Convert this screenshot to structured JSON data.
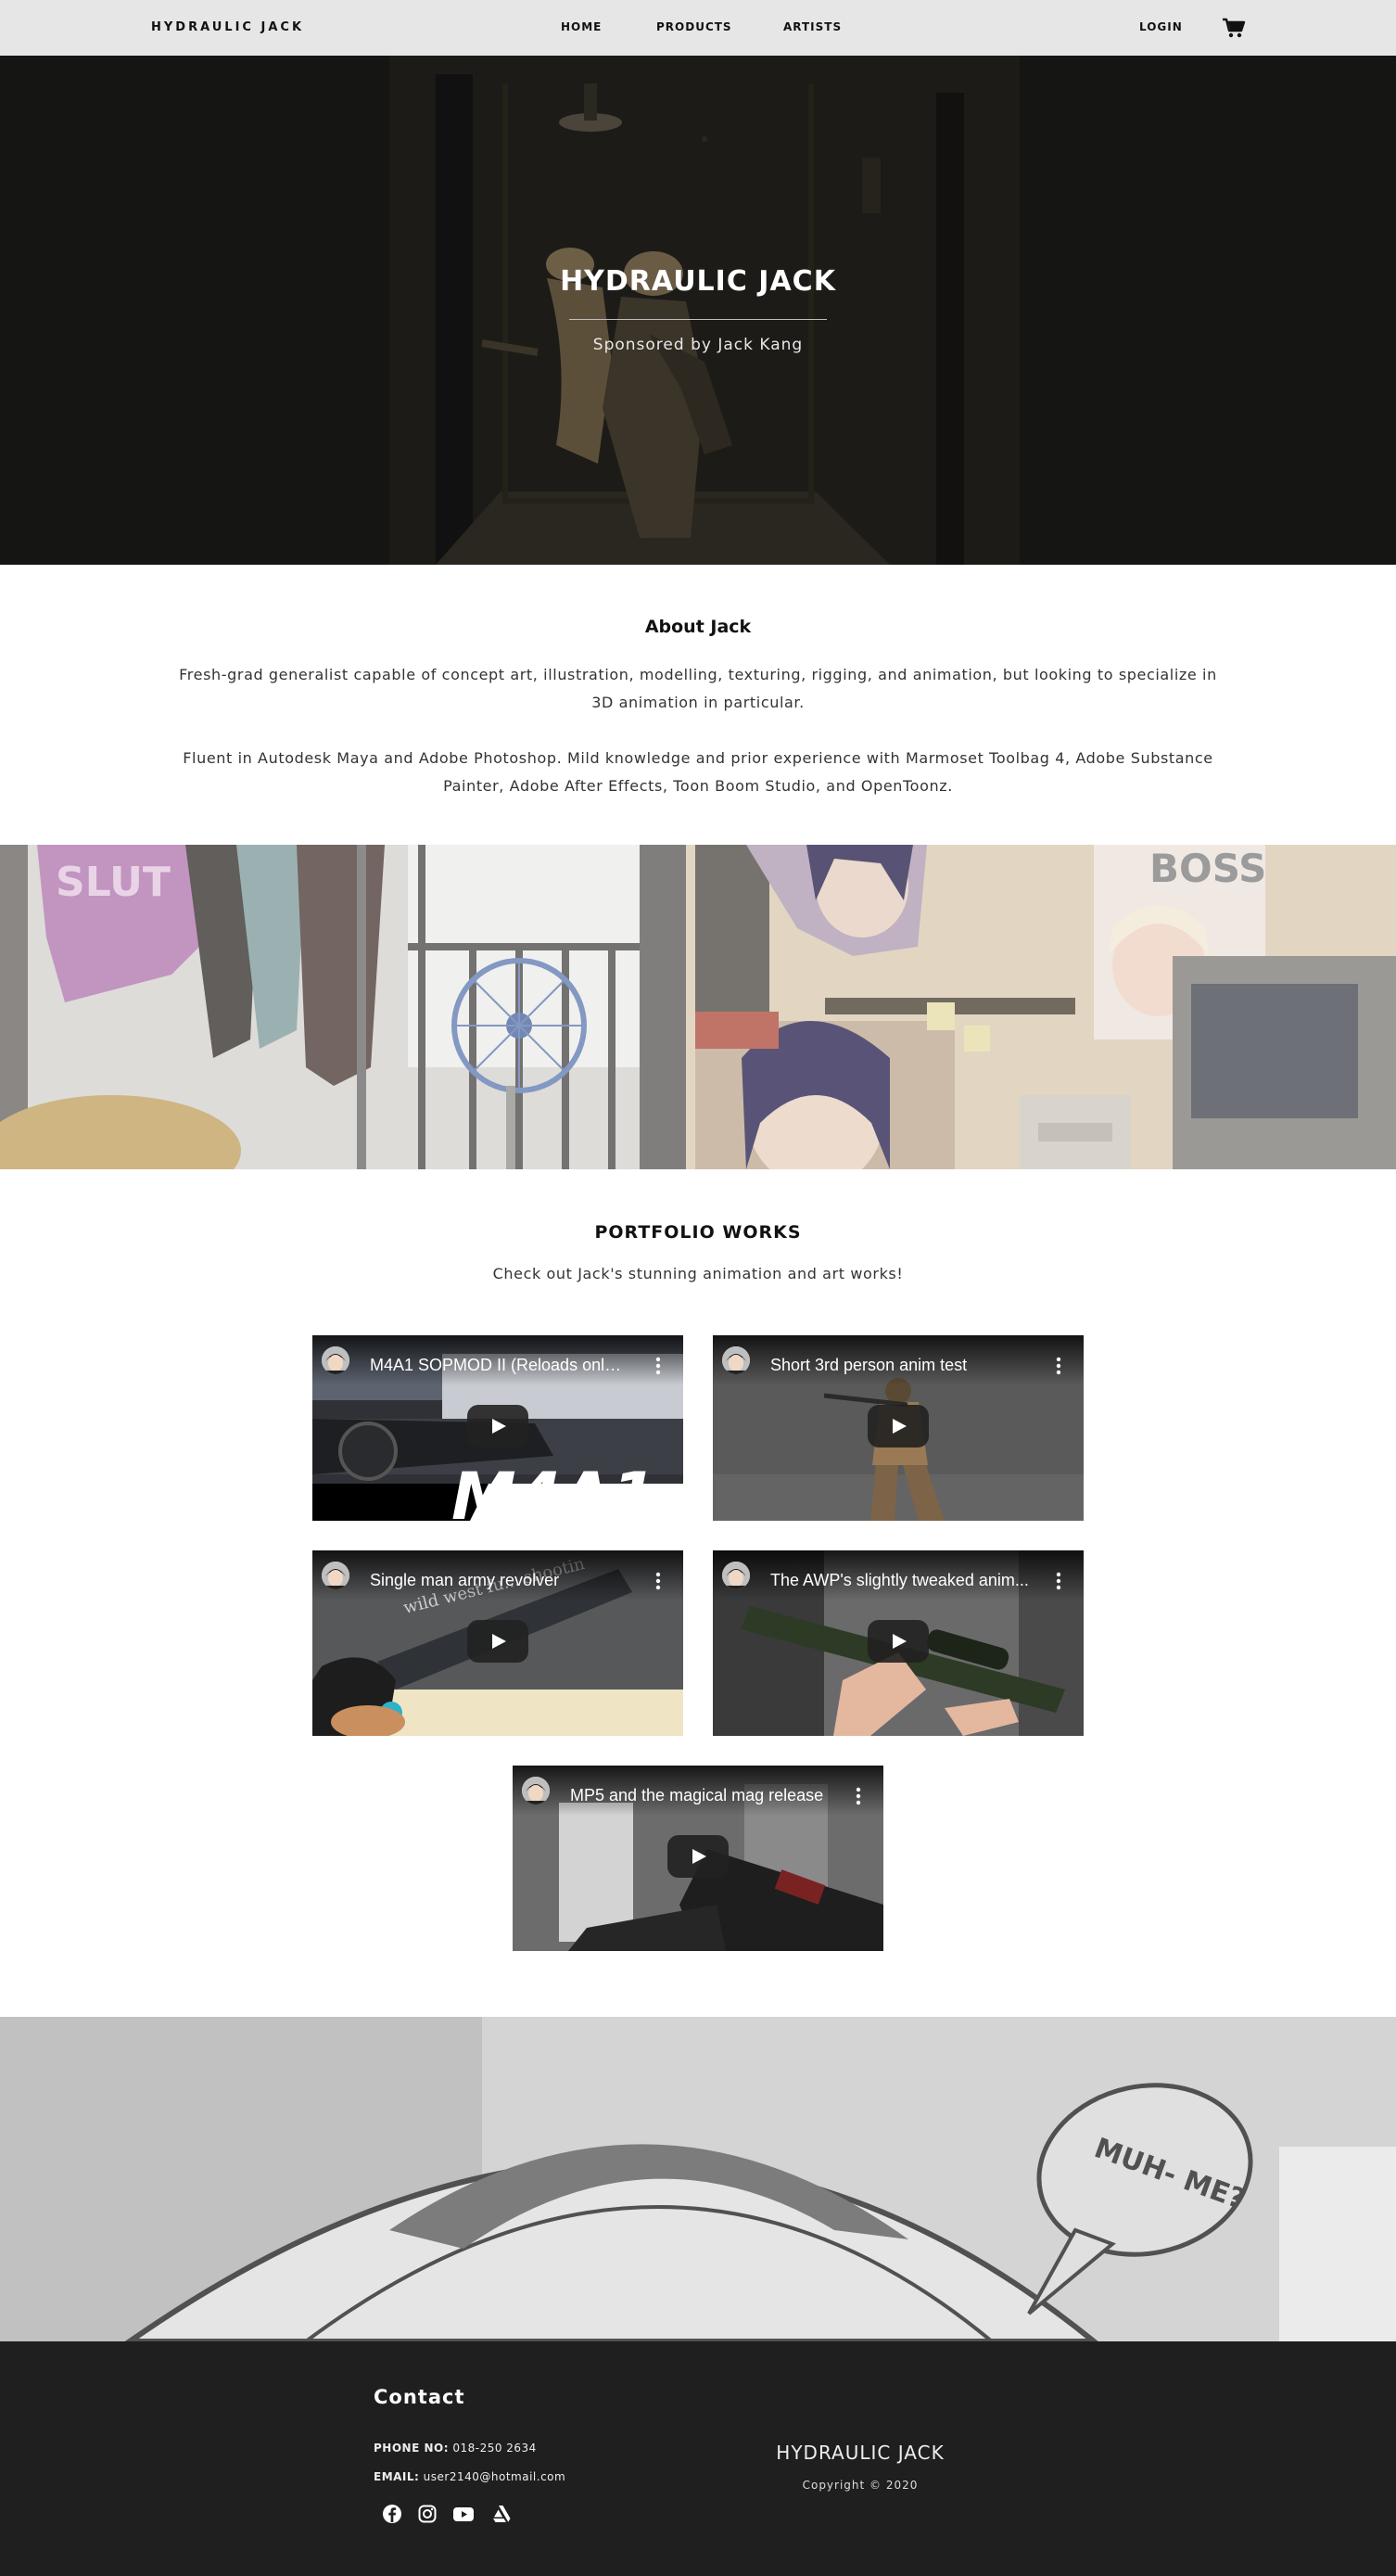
{
  "nav": {
    "brand": "HYDRAULIC JACK",
    "links": [
      "HOME",
      "PRODUCTS",
      "ARTISTS"
    ],
    "login": "LOGIN",
    "cart_icon": "shopping-cart-icon"
  },
  "hero": {
    "title": "HYDRAULIC JACK",
    "subtitle": "Sponsored by Jack Kang"
  },
  "about": {
    "title": "About Jack",
    "paragraphs": [
      "Fresh-grad generalist capable of concept art, illustration, modelling, texturing, rigging, and animation, but looking to specialize in 3D animation in particular.",
      "Fluent in Autodesk Maya and Adobe Photoshop. Mild knowledge and prior experience with Marmoset Toolbag 4, Adobe Substance Painter, Adobe After Effects, Toon Boom Studio, and OpenToonz."
    ]
  },
  "banner": {
    "shirt_text": "SLUT",
    "poster_text": "BOSS"
  },
  "portfolio": {
    "title": "PORTFOLIO WORKS",
    "subtitle": "Check out Jack's stunning animation and art works!",
    "videos": [
      {
        "title": "M4A1 SOPMOD II (Reloads only ...",
        "overlay": "M4A1"
      },
      {
        "title": "Short 3rd person anim test"
      },
      {
        "title": "Single man army revolver",
        "overlay": "wild west fu... shootin"
      },
      {
        "title": "The AWP's slightly tweaked anim..."
      },
      {
        "title": "MP5 and the magical mag release"
      }
    ]
  },
  "comic": {
    "bubble_text": "MUH- ME?"
  },
  "footer": {
    "contact_title": "Contact",
    "phone_label": "PHONE NO:",
    "phone": "018-250 2634",
    "email_label": "EMAIL:",
    "email": "user2140@hotmail.com",
    "social_icons": [
      "facebook-icon",
      "instagram-icon",
      "youtube-icon",
      "artstation-icon"
    ],
    "brand": "HYDRAULIC JACK",
    "copyright": "Copyright © 2020"
  }
}
